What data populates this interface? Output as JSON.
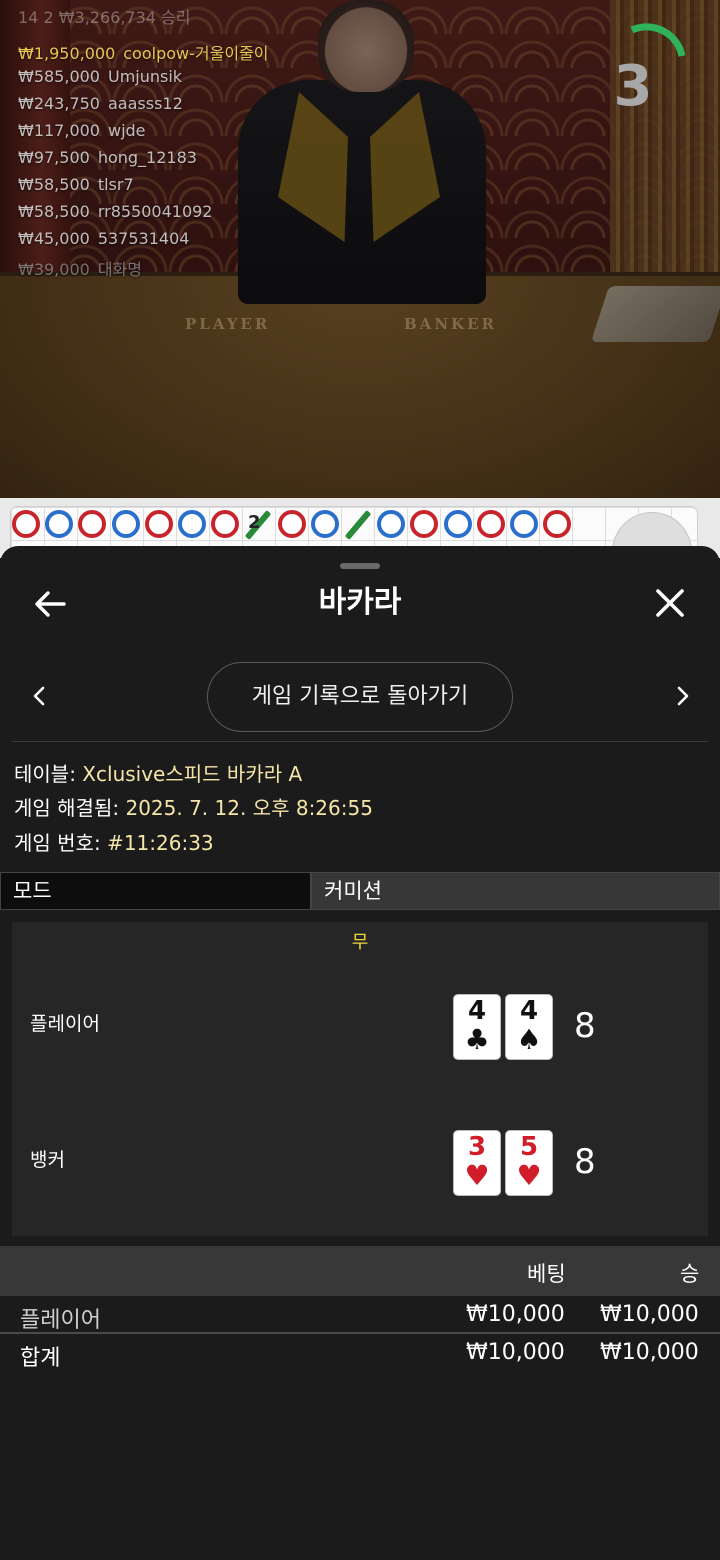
{
  "video": {
    "table_labels": {
      "player": "PLAYER",
      "banker": "BANKER"
    },
    "countdown": "3",
    "winners_total": "14 2 ₩3,266,734 승리",
    "winners": [
      {
        "amount": "₩1,950,000",
        "name": "coolpow-거울이줄이"
      },
      {
        "amount": "₩585,000",
        "name": "Umjunsik"
      },
      {
        "amount": "₩243,750",
        "name": "aaasss12"
      },
      {
        "amount": "₩117,000",
        "name": "wjde"
      },
      {
        "amount": "₩97,500",
        "name": "hong_12183"
      },
      {
        "amount": "₩58,500",
        "name": "tlsr7"
      },
      {
        "amount": "₩58,500",
        "name": "rr8550041092"
      },
      {
        "amount": "₩45,000",
        "name": "537531404"
      },
      {
        "amount": "₩39,000",
        "name": "대화명"
      }
    ]
  },
  "road": {
    "tie_count": "2",
    "beads": [
      "red",
      "blue",
      "red",
      "blue",
      "red",
      "blue",
      "red",
      "tie",
      "red",
      "blue",
      "tie",
      "blue",
      "red",
      "blue",
      "red",
      "blue",
      "red"
    ]
  },
  "sheet": {
    "title": "바카라",
    "back_icon": "arrow-left-icon",
    "close_icon": "close-icon",
    "history_button": "게임 기록으로 돌아가기",
    "info": {
      "table_label": "테이블:",
      "table_value": " Xclusive스피드 바카라 A",
      "resolved_label": "게임 해결됨:",
      "resolved_value": " 2025. 7. 12. 오후 8:26:55",
      "number_label": "게임 번호:",
      "number_value": " #11:26:33"
    },
    "tabs": {
      "mode": "모드",
      "commission": "커미션"
    },
    "result": {
      "outcome": "무",
      "player": {
        "label": "플레이어",
        "cards": [
          {
            "rank": "4",
            "suit": "♣",
            "color": "black"
          },
          {
            "rank": "4",
            "suit": "♠",
            "color": "black"
          }
        ],
        "score": "8"
      },
      "banker": {
        "label": "뱅커",
        "cards": [
          {
            "rank": "3",
            "suit": "♥",
            "color": "red"
          },
          {
            "rank": "5",
            "suit": "♥",
            "color": "red"
          }
        ],
        "score": "8"
      }
    },
    "bets": {
      "headers": {
        "bet": "베팅",
        "win": "승"
      },
      "rows": [
        {
          "name": "플레이어",
          "bet": "₩10,000",
          "win": "₩10,000"
        }
      ],
      "total": {
        "name": "합계",
        "bet": "₩10,000",
        "win": "₩10,000"
      }
    }
  },
  "colors": {
    "accent_gold": "#f5e6a8",
    "outcome_yellow": "#f0d63a",
    "winner_gold": "#e7c653",
    "countdown_green": "#2fb25a"
  }
}
